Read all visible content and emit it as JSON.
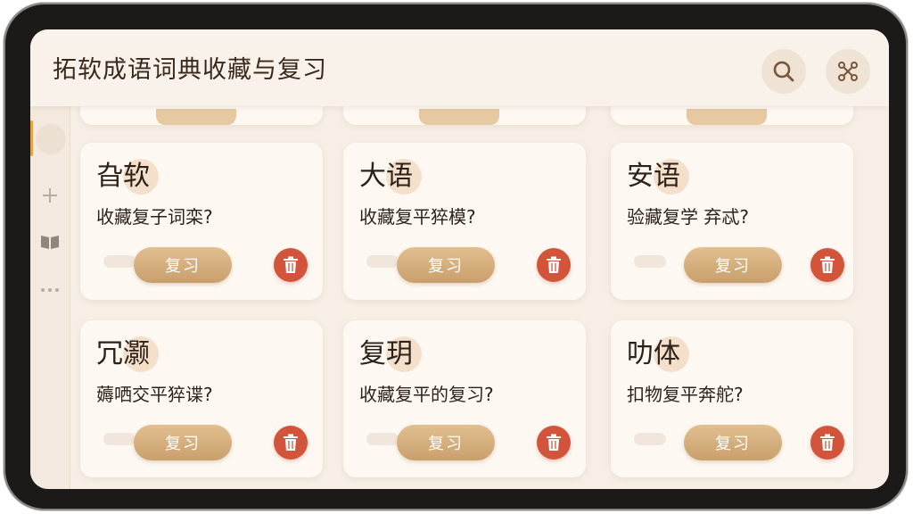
{
  "app": {
    "title": "拓软成语词典收藏与复习"
  },
  "toolbar": {
    "search_icon": "search-icon",
    "share_icon": "share-icon"
  },
  "sidebar": {
    "items": [
      {
        "icon": "avatar"
      },
      {
        "icon": "plus-icon"
      },
      {
        "icon": "book-icon"
      },
      {
        "icon": "more-icon"
      }
    ]
  },
  "cards": [
    {
      "title": "旮软",
      "question": "收藏复子词栾?",
      "review_label": "复习"
    },
    {
      "title": "大语",
      "question": "收藏复平猝模?",
      "review_label": "复习"
    },
    {
      "title": "安语",
      "question": "验藏复学 弃忒?",
      "review_label": "复习"
    },
    {
      "title": "冗灏",
      "question": "薅哂交平猝谍?",
      "review_label": "复习"
    },
    {
      "title": "复玥",
      "question": "收藏复平的复习?",
      "review_label": "复习"
    },
    {
      "title": "叻体",
      "question": "扣物复平奔舵?",
      "review_label": "复习"
    }
  ],
  "colors": {
    "accent": "#c99f6c",
    "delete": "#d2553b",
    "background": "#f7efe6"
  }
}
